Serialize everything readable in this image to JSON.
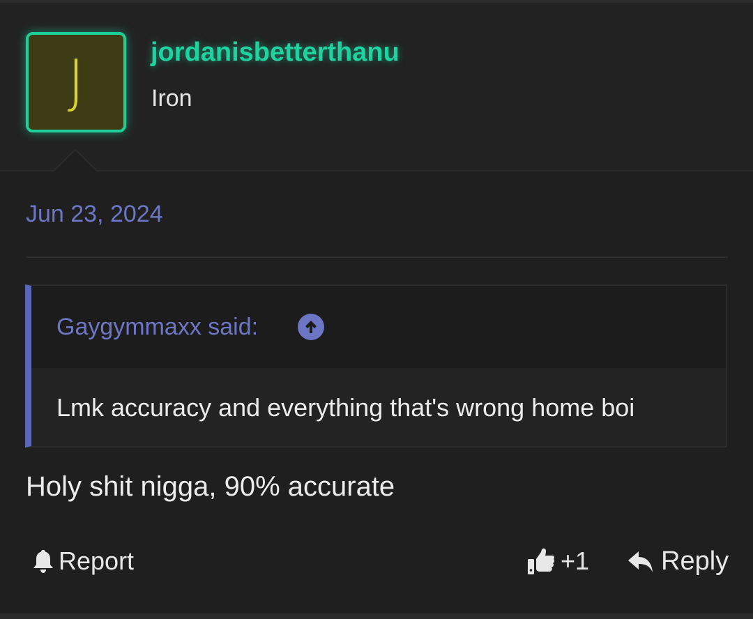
{
  "post": {
    "author": {
      "avatar_letter": "J",
      "username": "jordanisbetterthanu",
      "title": "Iron",
      "username_color": "#1fd3a0",
      "avatar_bg": "#3e3c14"
    },
    "date": "Jun 23, 2024",
    "quote": {
      "author_label": "Gaygymmaxx said:",
      "jump_icon": "arrow-up-circle-icon",
      "text": "Lmk accuracy and everything that's wrong home boi"
    },
    "message": "Holy shit nigga, 90% accurate",
    "actions": {
      "report_label": "Report",
      "report_icon": "bell-icon",
      "like_count": "+1",
      "like_icon": "thumbs-up-icon",
      "reply_label": "Reply",
      "reply_icon": "reply-arrow-icon"
    }
  },
  "colors": {
    "background": "#1f1f1f",
    "accent": "#6d76c4",
    "username_glow": "#1fcf9a"
  }
}
